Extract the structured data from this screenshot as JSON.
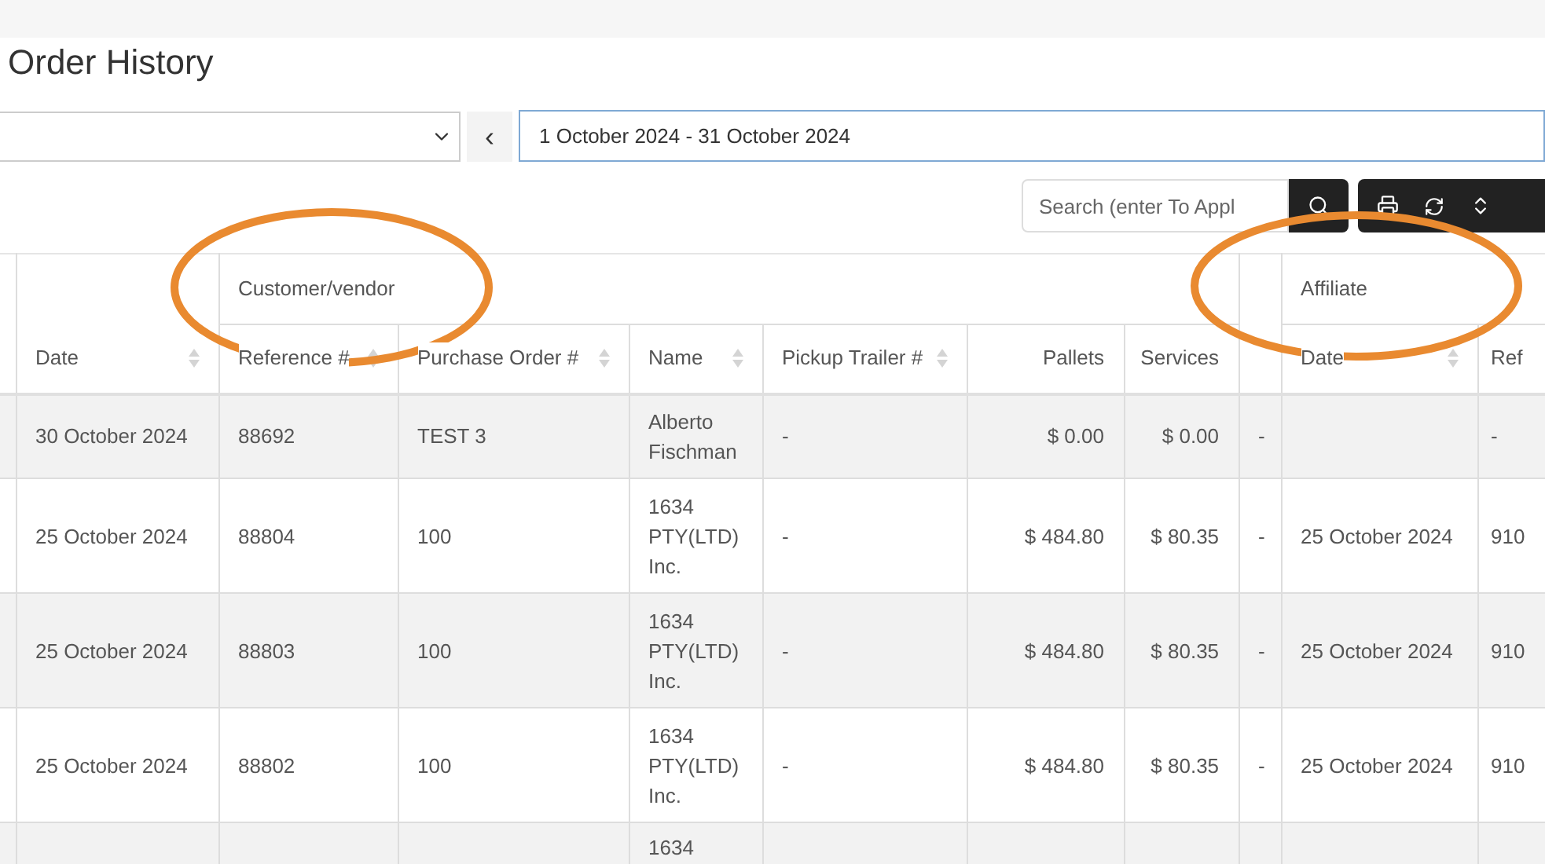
{
  "page_title": "Order History",
  "date_range": {
    "value": "1 October 2024 - 31 October 2024",
    "prev_button": "‹"
  },
  "search": {
    "placeholder": "Search (enter To Appl"
  },
  "table": {
    "group_headers": [
      {
        "kind": "customer",
        "label": "Customer/vendor"
      },
      {
        "kind": "affiliate",
        "label": "Affiliate"
      }
    ],
    "columns": [
      {
        "label": "Date",
        "sortable": true
      },
      {
        "label": "Reference #",
        "sortable": true
      },
      {
        "label": "Purchase Order #",
        "sortable": true
      },
      {
        "label": "Name",
        "sortable": true
      },
      {
        "label": "Pickup Trailer #",
        "sortable": true
      },
      {
        "label": "Pallets",
        "sortable": false
      },
      {
        "label": "Services",
        "sortable": false
      },
      {
        "sortable": false
      },
      {
        "label": "Date",
        "sortable": true
      },
      {
        "label": "Ref"
      }
    ],
    "rows": [
      {
        "cells": [
          "30 October 2024",
          "88692",
          "TEST 3",
          "Alberto Fischman",
          "-",
          "$ 0.00",
          "$ 0.00",
          "-",
          "",
          "-"
        ]
      },
      {
        "cells": [
          "25 October 2024",
          "88804",
          "100",
          "1634 PTY(LTD) Inc.",
          "-",
          "$ 484.80",
          "$ 80.35",
          "-",
          "25 October 2024",
          "910"
        ]
      },
      {
        "cells": [
          "25 October 2024",
          "88803",
          "100",
          "1634 PTY(LTD) Inc.",
          "-",
          "$ 484.80",
          "$ 80.35",
          "-",
          "25 October 2024",
          "910"
        ]
      },
      {
        "cells": [
          "25 October 2024",
          "88802",
          "100",
          "1634 PTY(LTD) Inc.",
          "-",
          "$ 484.80",
          "$ 80.35",
          "-",
          "25 October 2024",
          "910"
        ]
      },
      {
        "cells": [
          "",
          "",
          "",
          "1634",
          "",
          "",
          "",
          "",
          "",
          ""
        ]
      }
    ]
  }
}
